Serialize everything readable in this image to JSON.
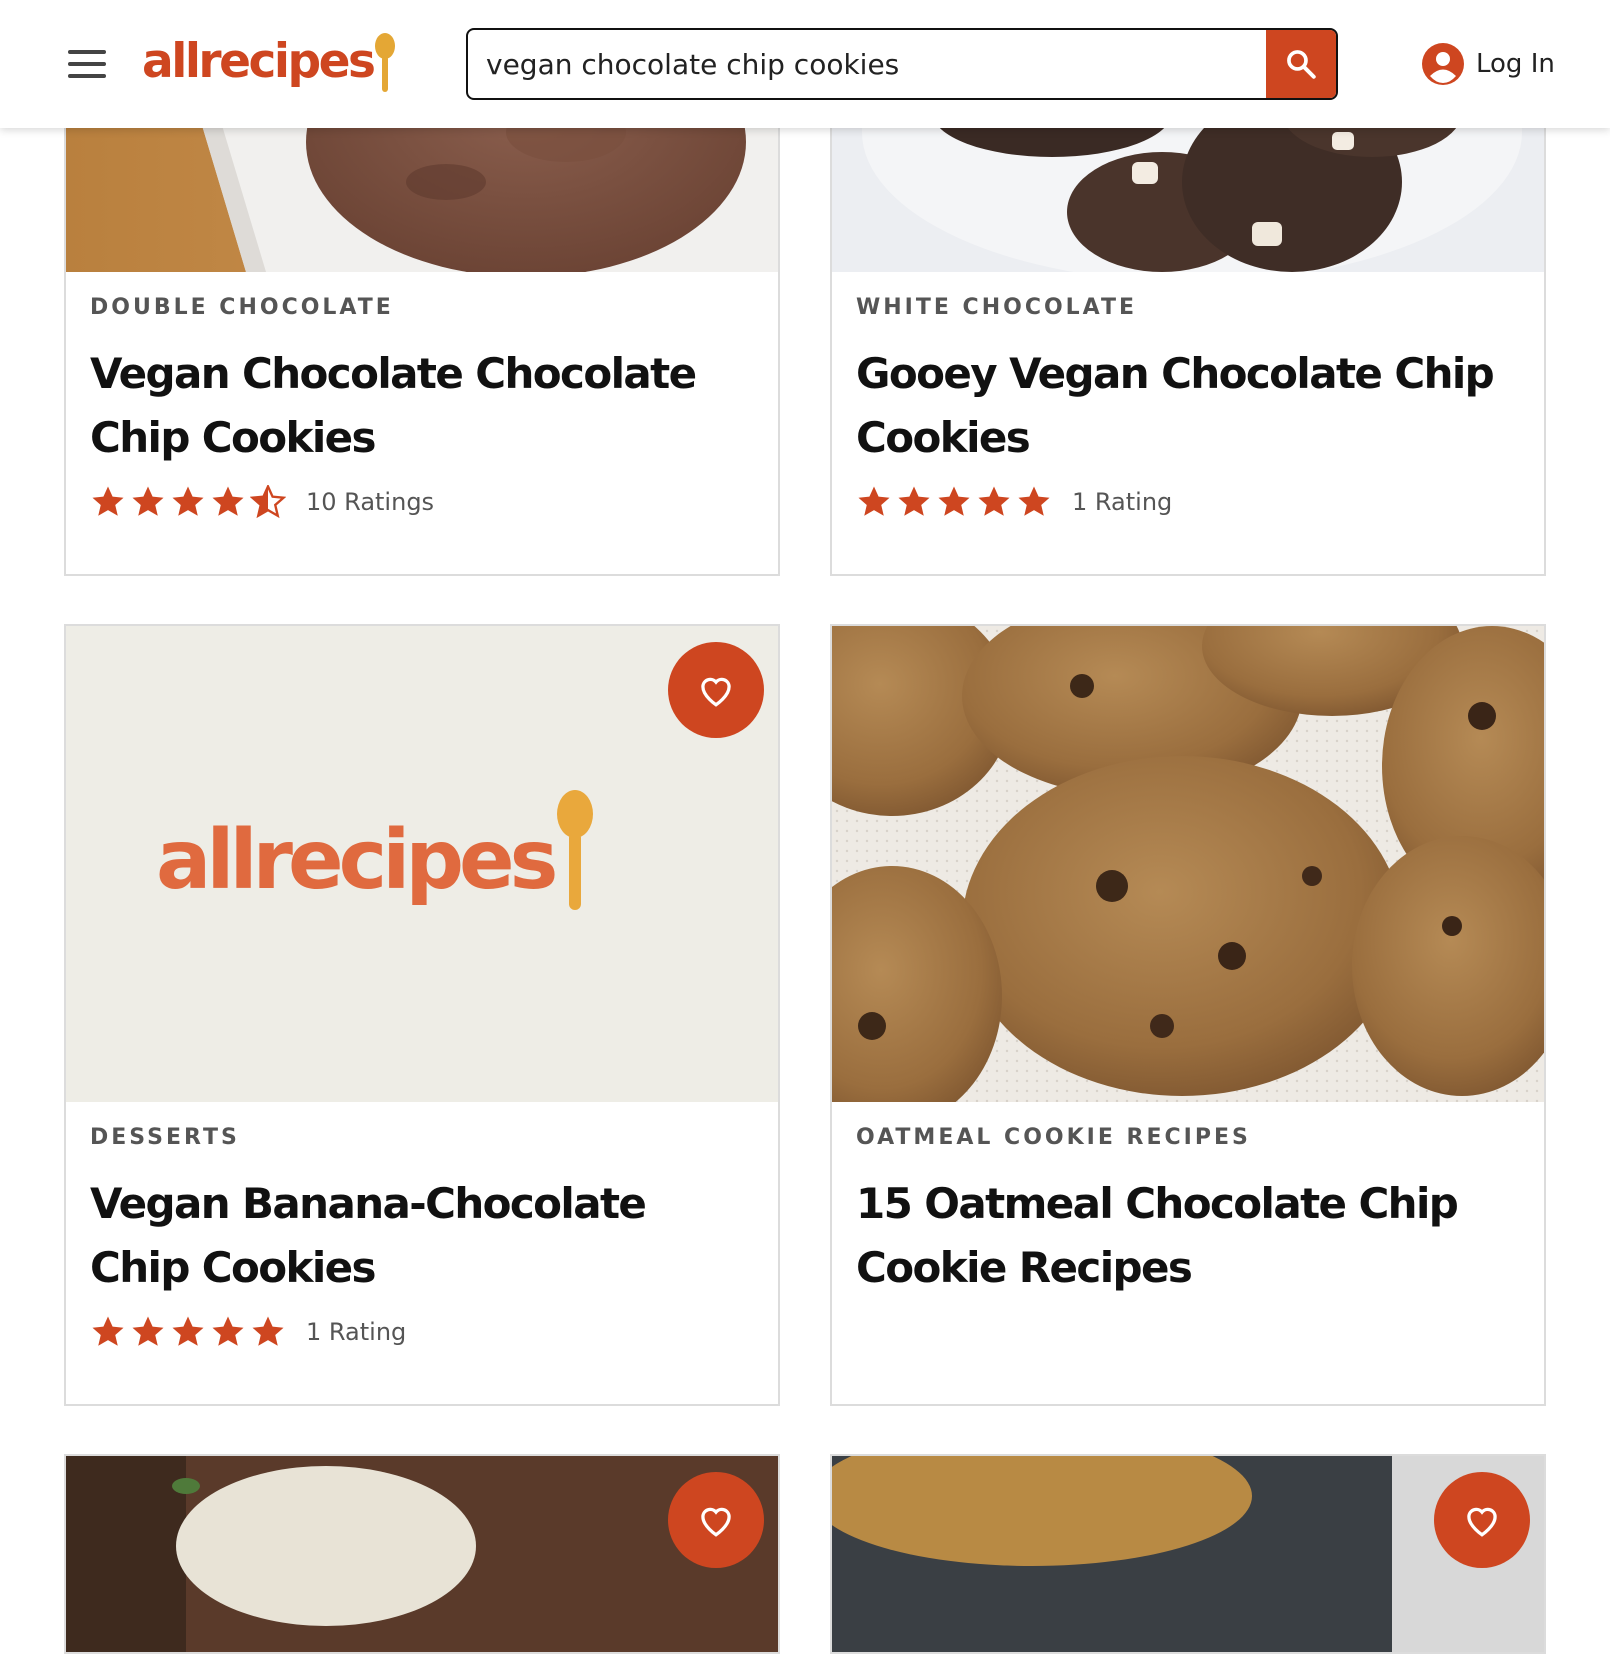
{
  "header": {
    "logo_text": "allrecipes",
    "search_value": "vegan chocolate chip cookies",
    "login_label": "Log In"
  },
  "colors": {
    "brand": "#ce4620",
    "spoon": "#e4a735",
    "text": "#111111"
  },
  "cards": [
    {
      "tag": "DOUBLE CHOCOLATE",
      "title": "Vegan Chocolate Chocolate Chip Cookies",
      "rating_stars": 4.5,
      "rating_count": "10 Ratings",
      "image": "chocolate cookie on plate"
    },
    {
      "tag": "WHITE CHOCOLATE",
      "title": "Gooey Vegan Chocolate Chip Cookies",
      "rating_stars": 5,
      "rating_count": "1 Rating",
      "image": "chocolate cookies with white chocolate chips"
    },
    {
      "tag": "DESSERTS",
      "title": "Vegan Banana-Chocolate Chip Cookies",
      "rating_stars": 5,
      "rating_count": "1 Rating",
      "image": "allrecipes placeholder logo",
      "placeholder_logo_text": "allrecipes"
    },
    {
      "tag": "OATMEAL COOKIE RECIPES",
      "title": "15 Oatmeal Chocolate Chip Cookie Recipes",
      "image": "oatmeal chocolate chip cookies on paper towel"
    }
  ],
  "icons": {
    "menu": "hamburger-icon",
    "search": "search-icon",
    "account": "user-circle-icon",
    "favorite": "heart-outline-icon",
    "star": "star-icon"
  }
}
